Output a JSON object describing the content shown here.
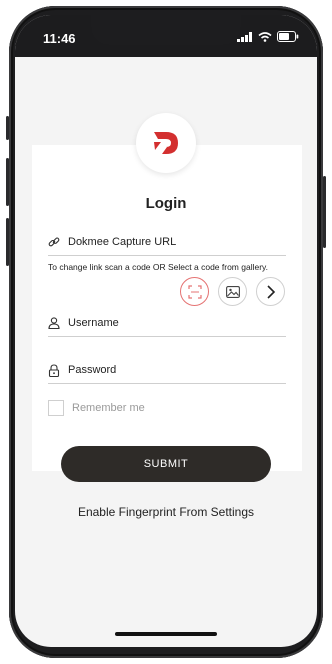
{
  "status_bar": {
    "time": "11:46",
    "icons": [
      "signal-icon",
      "wifi-icon",
      "battery-icon"
    ]
  },
  "app": {
    "logo_icon": "dokmee-logo-icon",
    "title": "Login",
    "brand_color": "#d32f2f"
  },
  "url_field": {
    "icon": "link-icon",
    "label": "Dokmee Capture URL"
  },
  "hint_text": "To change link scan a code OR Select a code from gallery.",
  "actions": [
    {
      "name": "scan-code-button",
      "icon": "scan-icon"
    },
    {
      "name": "gallery-button",
      "icon": "image-icon"
    },
    {
      "name": "next-button",
      "icon": "chevron-right-icon"
    }
  ],
  "username_field": {
    "icon": "user-icon",
    "label": "Username"
  },
  "password_field": {
    "icon": "lock-icon",
    "label": "Password"
  },
  "remember_me": {
    "label": "Remember me",
    "checked": false
  },
  "submit": {
    "label": "SUBMIT"
  },
  "fingerprint_text": "Enable Fingerprint From Settings"
}
